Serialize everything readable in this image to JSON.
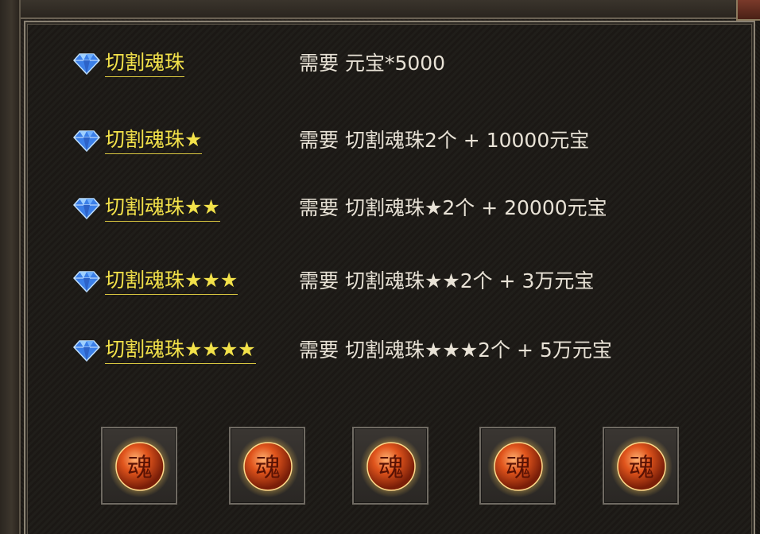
{
  "recipes": [
    {
      "name": "切割魂珠",
      "requirement": "需要 元宝*5000"
    },
    {
      "name": "切割魂珠★",
      "requirement": "需要 切割魂珠2个 + 10000元宝"
    },
    {
      "name": "切割魂珠★★",
      "requirement": "需要 切割魂珠★2个 + 20000元宝"
    },
    {
      "name": "切割魂珠★★★",
      "requirement": "需要  切割魂珠★★2个 + 3万元宝"
    },
    {
      "name": "切割魂珠★★★★",
      "requirement": "需要 切割魂珠★★★2个 + 5万元宝"
    }
  ],
  "slots": [
    {
      "glyph": "魂",
      "icon": "soul-orb-icon"
    },
    {
      "glyph": "魂",
      "icon": "soul-orb-icon"
    },
    {
      "glyph": "魂",
      "icon": "soul-orb-icon"
    },
    {
      "glyph": "魂",
      "icon": "soul-orb-icon"
    },
    {
      "glyph": "魂",
      "icon": "soul-orb-icon"
    }
  ],
  "colors": {
    "item_name": "#f3e24a",
    "requirement_text": "#e8e2d6",
    "panel_bg": "#1c1915",
    "orb": "#d9471a"
  }
}
